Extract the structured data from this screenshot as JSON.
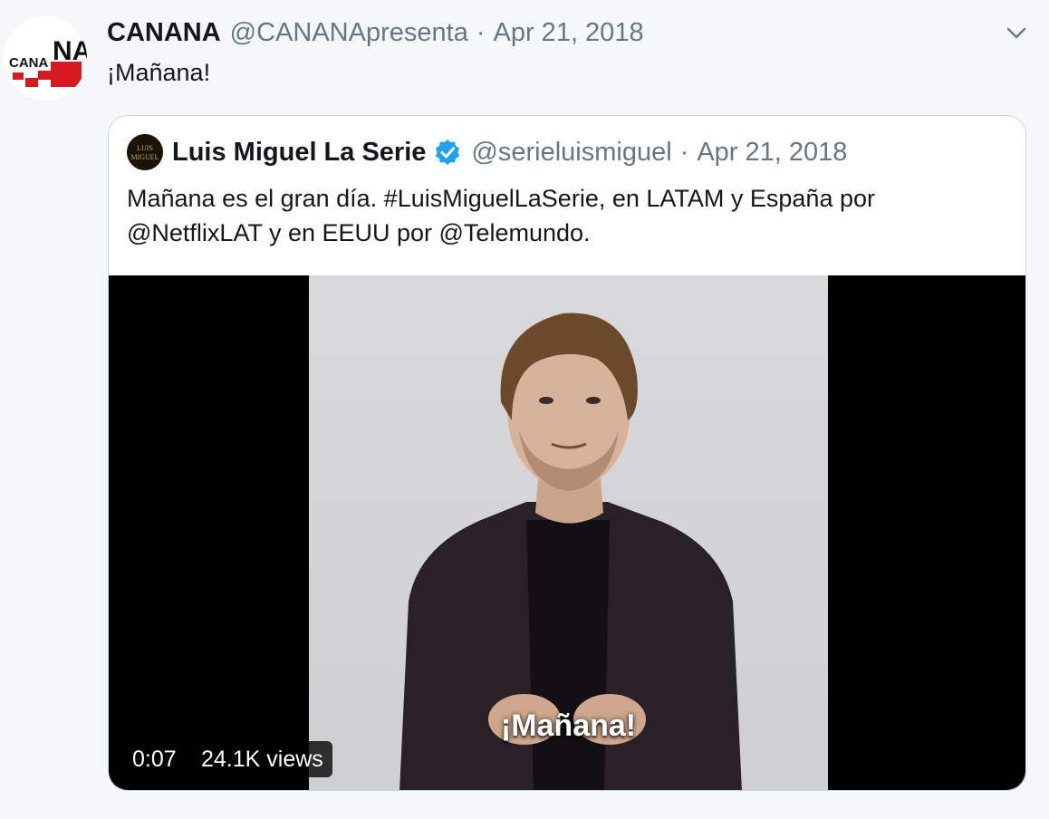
{
  "tweet": {
    "author_name": "CANANA",
    "author_handle": "@CANANApresenta",
    "separator": "·",
    "date": "Apr 21, 2018",
    "text": "¡Mañana!",
    "avatar_logo_text": "CANANA",
    "menu_icon": "chevron-down-icon"
  },
  "quoted_tweet": {
    "author_name": "Luis Miguel La Serie",
    "verified": true,
    "author_handle": "@serieluismiguel",
    "separator": "·",
    "date": "Apr 21, 2018",
    "text": "Mañana es el gran día. #LuisMiguelLaSerie, en LATAM y España por @NetflixLAT y en EEUU por @Telemundo.",
    "avatar_logo_text": "LUIS MIGUEL",
    "video": {
      "subtitle": "¡Mañana!",
      "duration": "0:07",
      "views": "24.1K views"
    }
  },
  "colors": {
    "background": "#f5f8fa",
    "text_primary": "#14171a",
    "text_secondary": "#657786",
    "verified_blue": "#1da1f2",
    "card_border": "#ccd6dd",
    "logo_red": "#d71920"
  }
}
